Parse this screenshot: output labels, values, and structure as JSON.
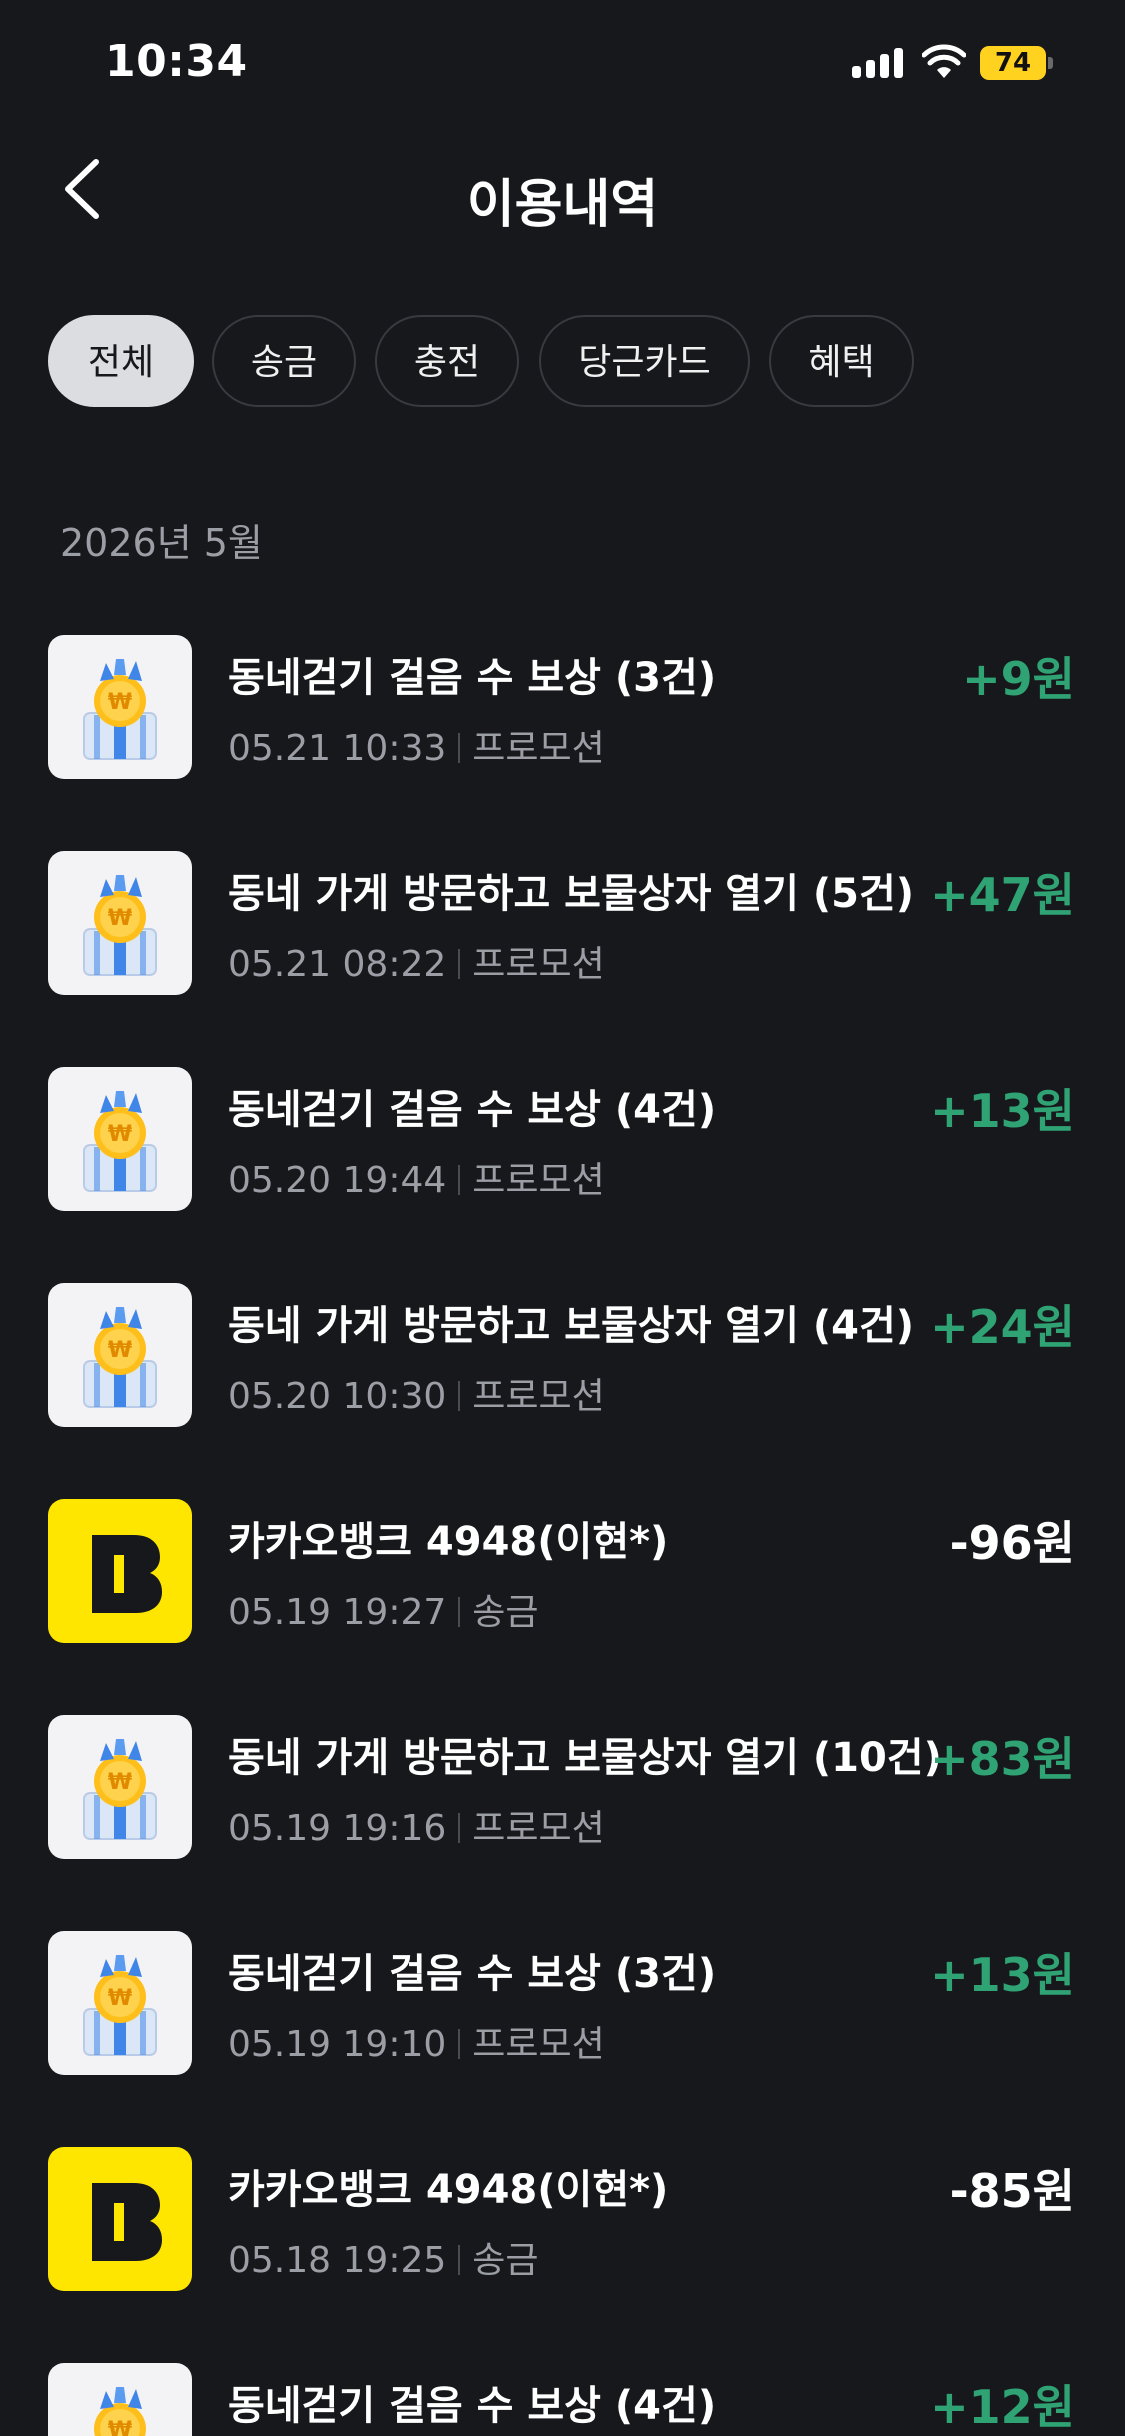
{
  "status_bar": {
    "time": "10:34",
    "battery": "74"
  },
  "header": {
    "title": "이용내역"
  },
  "tabs": [
    {
      "label": "전체",
      "active": true
    },
    {
      "label": "송금",
      "active": false
    },
    {
      "label": "충전",
      "active": false
    },
    {
      "label": "당근카드",
      "active": false
    },
    {
      "label": "혜택",
      "active": false
    }
  ],
  "section": {
    "month": "2026년 5월"
  },
  "transactions": [
    {
      "icon": "gift-icon",
      "title": "동네걷기 걸음 수 보상 (3건)",
      "datetime": "05.21 10:33",
      "category": "프로모션",
      "amount": "+9원",
      "type": "plus"
    },
    {
      "icon": "gift-icon",
      "title": "동네 가게 방문하고 보물상자 열기 (5건)",
      "datetime": "05.21 08:22",
      "category": "프로모션",
      "amount": "+47원",
      "type": "plus"
    },
    {
      "icon": "gift-icon",
      "title": "동네걷기 걸음 수 보상 (4건)",
      "datetime": "05.20 19:44",
      "category": "프로모션",
      "amount": "+13원",
      "type": "plus"
    },
    {
      "icon": "gift-icon",
      "title": "동네 가게 방문하고 보물상자 열기 (4건)",
      "datetime": "05.20 10:30",
      "category": "프로모션",
      "amount": "+24원",
      "type": "plus"
    },
    {
      "icon": "bank-icon",
      "title": "카카오뱅크 4948(이현*)",
      "datetime": "05.19 19:27",
      "category": "송금",
      "amount": "-96원",
      "type": "minus"
    },
    {
      "icon": "gift-icon",
      "title": "동네 가게 방문하고 보물상자 열기 (10건)",
      "datetime": "05.19 19:16",
      "category": "프로모션",
      "amount": "+83원",
      "type": "plus"
    },
    {
      "icon": "gift-icon",
      "title": "동네걷기 걸음 수 보상 (3건)",
      "datetime": "05.19 19:10",
      "category": "프로모션",
      "amount": "+13원",
      "type": "plus"
    },
    {
      "icon": "bank-icon",
      "title": "카카오뱅크 4948(이현*)",
      "datetime": "05.18 19:25",
      "category": "송금",
      "amount": "-85원",
      "type": "minus"
    },
    {
      "icon": "gift-icon",
      "title": "동네걷기 걸음 수 보상 (4건)",
      "datetime": "",
      "category": "",
      "amount": "+12원",
      "type": "plus"
    }
  ],
  "colors": {
    "background": "#17181c",
    "positive": "#2fa374",
    "muted": "#9c9ea6",
    "bank_brand": "#ffe600"
  }
}
